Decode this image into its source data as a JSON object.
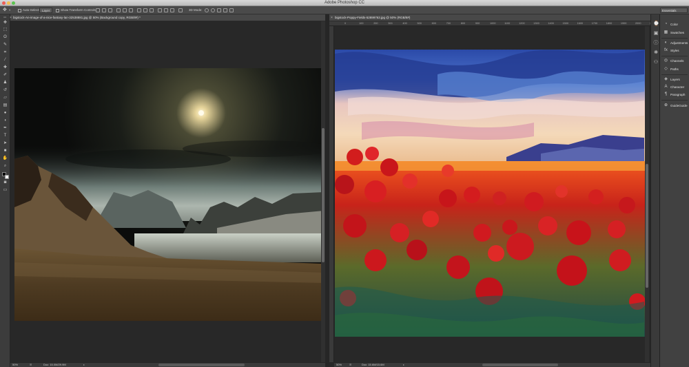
{
  "app": {
    "title": "Adobe Photoshop CC"
  },
  "options_bar": {
    "auto_select_label": "Auto-Select:",
    "auto_select_value": "Layer",
    "show_transform_label": "Show Transform Controls",
    "mode_3d_label": "3D Mode:",
    "workspace": "Essentials"
  },
  "documents": [
    {
      "tab_title": "bigstock-An-image-of-a-nice-fantasy-lan-32538881.jpg @ 50% (Background copy, RGB/8#) *",
      "zoom": "50%",
      "doc_info": "Doc: 15.0M/29.9M"
    },
    {
      "tab_title": "bigstock-Poppy-Fields-52899763.jpg @ 50% (RGB/8#)",
      "zoom": "50%",
      "doc_info": "Doc: 15.6M/15.6M",
      "ruler_ticks": [
        "0",
        "100",
        "200",
        "300",
        "400",
        "500",
        "600",
        "700",
        "800",
        "900",
        "1000",
        "1100",
        "1200",
        "1300",
        "1400",
        "1500",
        "1600",
        "1700",
        "1800",
        "1900",
        "2000",
        "2100"
      ]
    }
  ],
  "panels": [
    {
      "label": "Color",
      "icon": "color-wheel-icon"
    },
    {
      "label": "Swatches",
      "icon": "swatches-grid-icon"
    },
    {
      "label": "Adjustments",
      "icon": "adjustments-icon"
    },
    {
      "label": "Styles",
      "icon": "styles-icon"
    },
    {
      "label": "Channels",
      "icon": "channels-icon"
    },
    {
      "label": "Paths",
      "icon": "paths-icon"
    },
    {
      "label": "Layers",
      "icon": "layers-icon"
    },
    {
      "label": "Character",
      "icon": "character-icon"
    },
    {
      "label": "Paragraph",
      "icon": "paragraph-icon"
    },
    {
      "label": "GuideGuide",
      "icon": "guideguide-icon"
    }
  ],
  "colors": {
    "canvas_bg": "#282828",
    "chrome": "#3c3c3c",
    "foreground_swatch": "#000000",
    "background_swatch": "#ffffff"
  }
}
